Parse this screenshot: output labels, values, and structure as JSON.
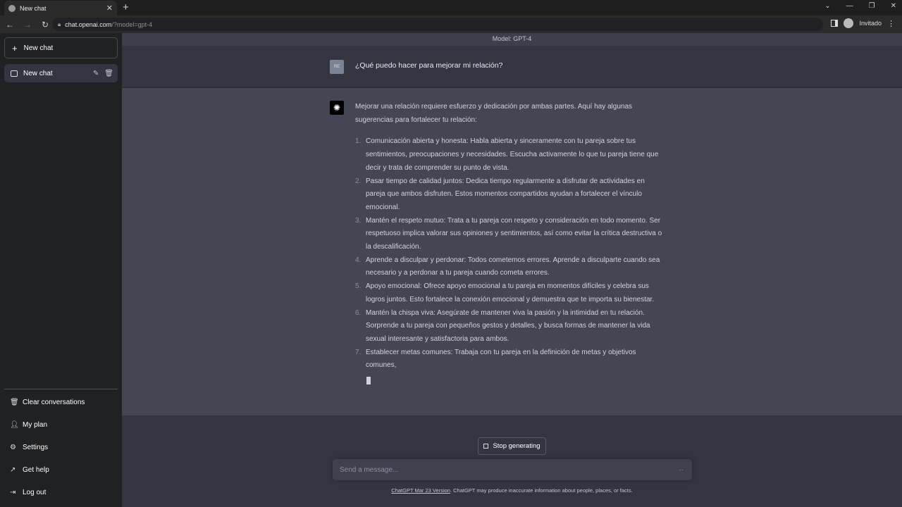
{
  "browser": {
    "tab_title": "New chat",
    "url_host": "chat.openai.com",
    "url_path": "/?model=gpt-4",
    "profile_label": "Invitado"
  },
  "sidebar": {
    "new_chat_label": "New chat",
    "chats": [
      {
        "title": "New chat"
      }
    ],
    "menu": [
      {
        "label": "Clear conversations",
        "icon": "trash-icon"
      },
      {
        "label": "My plan",
        "icon": "user-icon"
      },
      {
        "label": "Settings",
        "icon": "gear-icon"
      },
      {
        "label": "Get help",
        "icon": "external-link-icon"
      },
      {
        "label": "Log out",
        "icon": "logout-icon"
      }
    ]
  },
  "main": {
    "model_label": "Model: GPT-4",
    "user_avatar_text": "RE",
    "user_message": "¿Qué puedo hacer para mejorar mi relación?",
    "assistant_intro": "Mejorar una relación requiere esfuerzo y dedicación por ambas partes. Aquí hay algunas sugerencias para fortalecer tu relación:",
    "assistant_items": [
      {
        "num": "1.",
        "text": "Comunicación abierta y honesta: Habla abierta y sinceramente con tu pareja sobre tus sentimientos, preocupaciones y necesidades. Escucha activamente lo que tu pareja tiene que decir y trata de comprender su punto de vista."
      },
      {
        "num": "2.",
        "text": "Pasar tiempo de calidad juntos: Dedica tiempo regularmente a disfrutar de actividades en pareja que ambos disfruten. Estos momentos compartidos ayudan a fortalecer el vínculo emocional."
      },
      {
        "num": "3.",
        "text": "Mantén el respeto mutuo: Trata a tu pareja con respeto y consideración en todo momento. Ser respetuoso implica valorar sus opiniones y sentimientos, así como evitar la crítica destructiva o la descalificación."
      },
      {
        "num": "4.",
        "text": "Aprende a disculpar y perdonar: Todos cometemos errores. Aprende a disculparte cuando sea necesario y a perdonar a tu pareja cuando cometa errores."
      },
      {
        "num": "5.",
        "text": "Apoyo emocional: Ofrece apoyo emocional a tu pareja en momentos difíciles y celebra sus logros juntos. Esto fortalece la conexión emocional y demuestra que te importa su bienestar."
      },
      {
        "num": "6.",
        "text": "Mantén la chispa viva: Asegúrate de mantener viva la pasión y la intimidad en tu relación. Sorprende a tu pareja con pequeños gestos y detalles, y busca formas de mantener la vida sexual interesante y satisfactoria para ambos."
      },
      {
        "num": "7.",
        "text": "Establecer metas comunes: Trabaja con tu pareja en la definición de metas y objetivos comunes,"
      }
    ],
    "stop_label": "Stop generating",
    "input_placeholder": "Send a message...",
    "footer_link": "ChatGPT Mar 23 Version",
    "footer_text": ". ChatGPT may produce inaccurate information about people, places, or facts."
  }
}
